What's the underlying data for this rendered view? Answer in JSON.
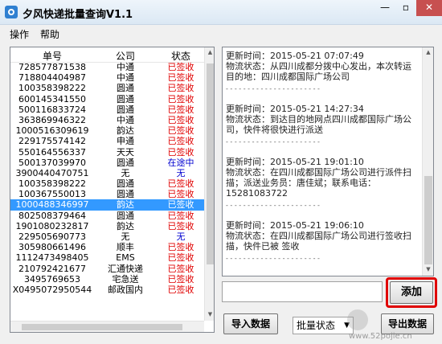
{
  "window": {
    "title": "夕风快递批量查询V1.1",
    "min_label": "—",
    "max_label": "▫",
    "close_label": "✕"
  },
  "menu": [
    "操作",
    "帮助"
  ],
  "list": {
    "headers": [
      "单号",
      "公司",
      "状态"
    ],
    "rows": [
      {
        "no": "728577871538",
        "company": "中通",
        "status": "已签收",
        "color": "red"
      },
      {
        "no": "718804404987",
        "company": "中通",
        "status": "已签收",
        "color": "red"
      },
      {
        "no": "100358398222",
        "company": "圆通",
        "status": "已签收",
        "color": "red"
      },
      {
        "no": "600145341550",
        "company": "圆通",
        "status": "已签收",
        "color": "red"
      },
      {
        "no": "500116833724",
        "company": "圆通",
        "status": "已签收",
        "color": "red"
      },
      {
        "no": "363869946322",
        "company": "中通",
        "status": "已签收",
        "color": "red"
      },
      {
        "no": "1000516309619",
        "company": "韵达",
        "status": "已签收",
        "color": "red"
      },
      {
        "no": "229175574142",
        "company": "申通",
        "status": "已签收",
        "color": "red"
      },
      {
        "no": "550164556337",
        "company": "天天",
        "status": "已签收",
        "color": "red"
      },
      {
        "no": "500137039970",
        "company": "圆通",
        "status": "在途中",
        "color": "blue"
      },
      {
        "no": "3900440470751",
        "company": "无",
        "status": "无",
        "color": "blue"
      },
      {
        "no": "100358398222",
        "company": "圆通",
        "status": "已签收",
        "color": "red"
      },
      {
        "no": "100367550013",
        "company": "圆通",
        "status": "已签收",
        "color": "red"
      },
      {
        "no": "1000488346997",
        "company": "韵达",
        "status": "已签收",
        "color": "red",
        "selected": true
      },
      {
        "no": "802508379464",
        "company": "圆通",
        "status": "已签收",
        "color": "red"
      },
      {
        "no": "1901080232817",
        "company": "韵达",
        "status": "已签收",
        "color": "red"
      },
      {
        "no": "229505690773",
        "company": "无",
        "status": "无",
        "color": "blue"
      },
      {
        "no": "305980661496",
        "company": "顺丰",
        "status": "已签收",
        "color": "red"
      },
      {
        "no": "1112473498405",
        "company": "EMS",
        "status": "已签收",
        "color": "red"
      },
      {
        "no": "210792421677",
        "company": "汇通快递",
        "status": "已签收",
        "color": "red"
      },
      {
        "no": "3495769653",
        "company": "宅急送",
        "status": "已签收",
        "color": "red"
      },
      {
        "no": "X0495072950544",
        "company": "邮政国内",
        "status": "已签收",
        "color": "red"
      }
    ]
  },
  "detail": {
    "entries": [
      {
        "time": "更新时间：2015-05-21 07:07:49",
        "status": "物流状态：从四川成都分拨中心发出，本次转运目的地：四川成都国际广场公司",
        "sep": "- - - - - - - - - - - - - - - - - - - - - -"
      },
      {
        "time": "更新时间：2015-05-21 14:27:34",
        "status": "物流状态：到达目的地网点四川成都国际广场公司，快件将很快进行派送",
        "sep": "- - - - - - - - - - - - - - - - - - - - - -"
      },
      {
        "time": "更新时间：2015-05-21 19:01:10",
        "status": "物流状态：在四川成都国际广场公司进行派件扫描；派送业务员：唐佳斌；联系电话：15281083722",
        "sep": "- - - - - - - - - - - - - - - - - - - - - -"
      },
      {
        "time": "更新时间：2015-05-21 19:06:10",
        "status": "物流状态：在四川成都国际广场公司进行签收扫描，快件已被  签收",
        "sep": "- - - - - - - - - - - - - - - - - - - - - -"
      }
    ]
  },
  "input": {
    "value": ""
  },
  "buttons": {
    "add": "添加",
    "import": "导入数据",
    "export": "导出数据"
  },
  "select": {
    "value": "批量状态"
  },
  "watermark": {
    "text": "www.52pojie.cn"
  },
  "colors": {
    "red": "#e00000",
    "blue": "#0000d0",
    "selected": "#3399ff",
    "highlight": "#e00000"
  }
}
